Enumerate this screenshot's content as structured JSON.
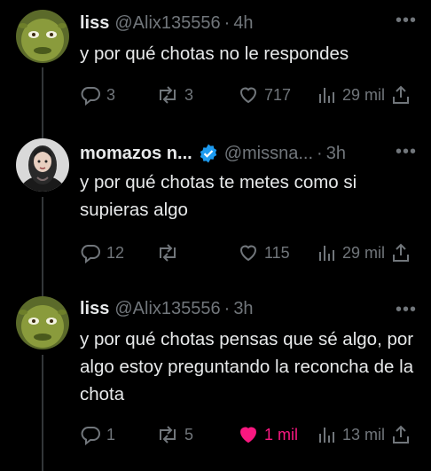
{
  "tweets": [
    {
      "name": "liss",
      "handle": "@Alix135556",
      "time": "4h",
      "text": "y por qué chotas no le respondes",
      "replies": "3",
      "retweets": "3",
      "likes": "717",
      "views": "29 mil",
      "liked": false
    },
    {
      "name": "momazos n...",
      "handle": "@missna...",
      "time": "3h",
      "verified": true,
      "text": "y por qué chotas te metes como si supieras algo",
      "replies": "12",
      "retweets": "",
      "likes": "115",
      "views": "29 mil",
      "liked": false
    },
    {
      "name": "liss",
      "handle": "@Alix135556",
      "time": "3h",
      "text": "y por qué chotas pensas que sé algo, por algo estoy preguntando la reconcha de la chota",
      "replies": "1",
      "retweets": "5",
      "likes": "1 mil",
      "views": "13 mil",
      "liked": true
    }
  ],
  "colors": {
    "background": "#000000",
    "text": "#e7e9ea",
    "muted": "#71767b",
    "like": "#f91880",
    "verified": "#1d9bf0"
  },
  "icons": [
    "reply-icon",
    "retweet-icon",
    "heart-icon",
    "views-icon",
    "share-icon",
    "more-icon",
    "verified-icon"
  ]
}
